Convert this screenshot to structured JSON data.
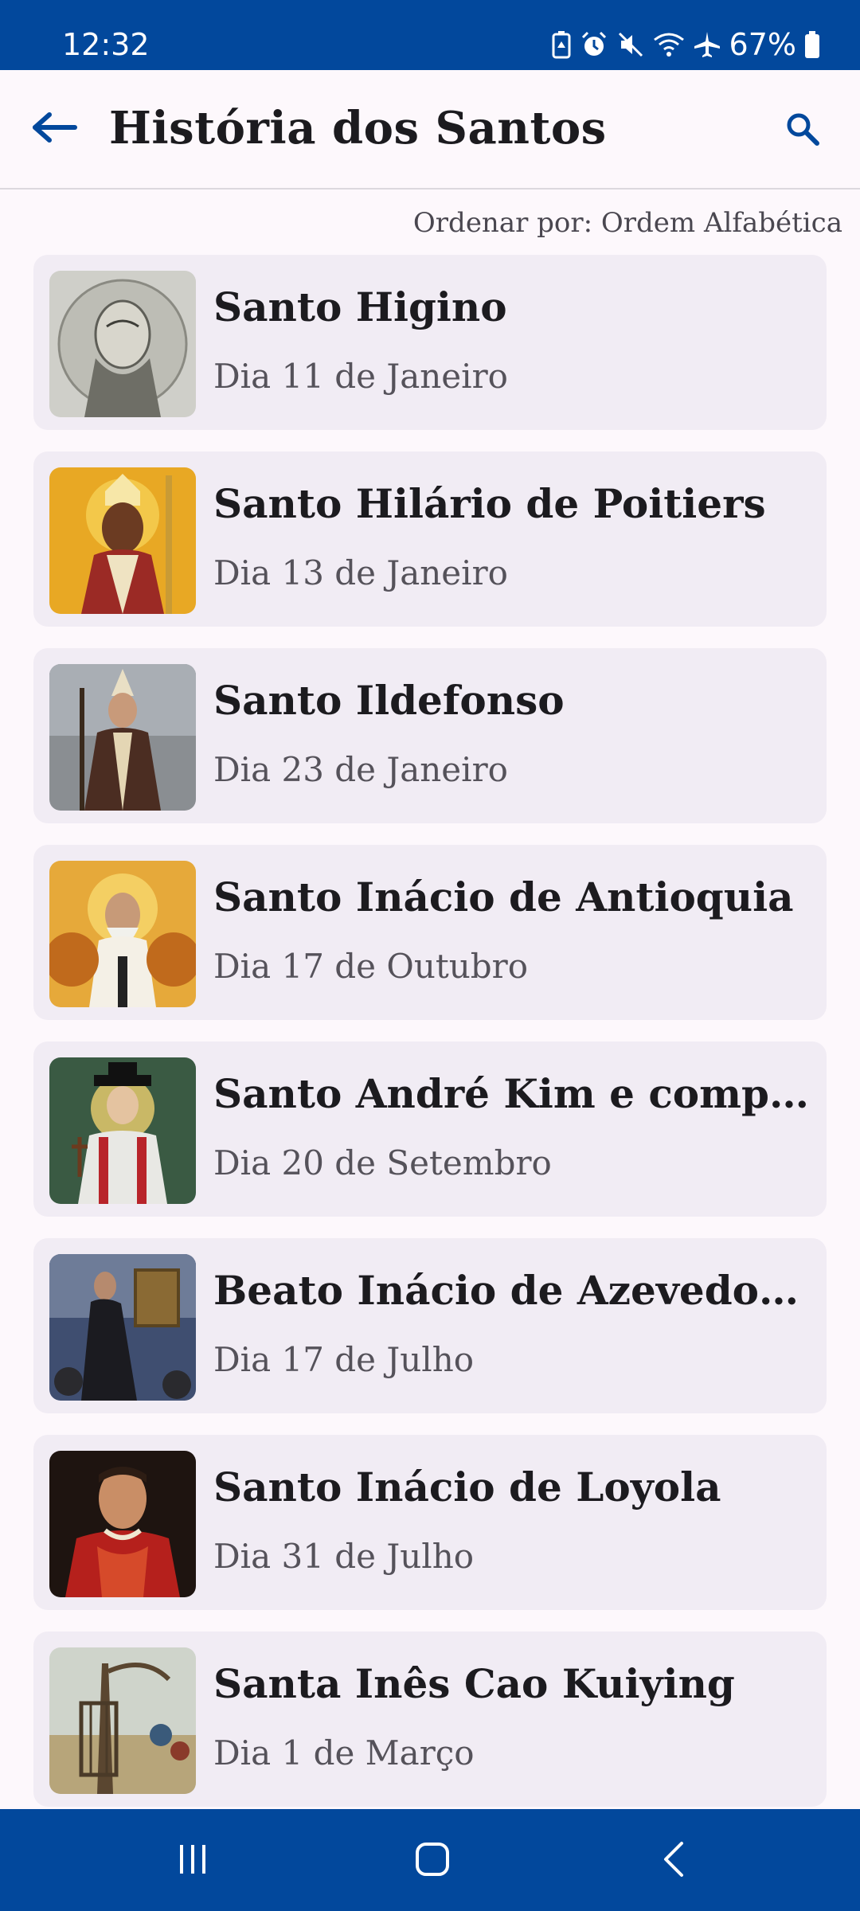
{
  "status_bar": {
    "time": "12:32",
    "battery": "67%",
    "icons": [
      "battery-saver-icon",
      "alarm-icon",
      "mute-icon",
      "wifi-icon",
      "airplane-icon",
      "battery-icon"
    ]
  },
  "app_bar": {
    "title": "História dos Santos",
    "back_icon": "arrow-left-icon",
    "search_icon": "search-icon"
  },
  "sort": {
    "label": "Ordenar por: Ordem Alfabética"
  },
  "saints": [
    {
      "name": "Santo Higino",
      "date": "Dia 11 de Janeiro"
    },
    {
      "name": "Santo Hilário de Poitiers",
      "date": "Dia 13 de Janeiro"
    },
    {
      "name": "Santo Ildefonso",
      "date": "Dia 23 de Janeiro"
    },
    {
      "name": "Santo Inácio de Antioquia",
      "date": "Dia 17 de Outubro"
    },
    {
      "name": "Santo André Kim e companh...",
      "date": "Dia 20 de Setembro"
    },
    {
      "name": "Beato Inácio de Azevedo e Co...",
      "date": "Dia 17 de Julho"
    },
    {
      "name": "Santo Inácio de Loyola",
      "date": "Dia 31 de Julho"
    },
    {
      "name": "Santa Inês Cao Kuiying",
      "date": "Dia 1 de Março"
    }
  ],
  "nav_bar": {
    "icons": [
      "recent-apps-icon",
      "home-icon",
      "back-icon"
    ]
  },
  "colors": {
    "primary": "#02489c",
    "background": "#fdf8fc",
    "card": "#f1ecf4",
    "text": "#1c1b1f",
    "secondary_text": "#55525a"
  }
}
